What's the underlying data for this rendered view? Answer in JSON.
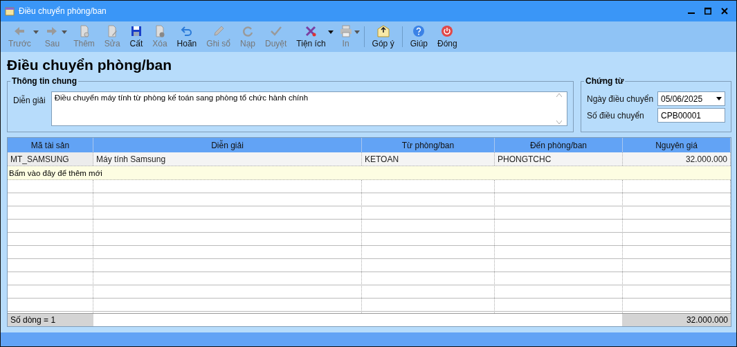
{
  "window": {
    "title": "Điều chuyển phòng/ban"
  },
  "toolbar_groups": [
    {
      "items": [
        {
          "label": "Trước",
          "disabled": true,
          "dropdown": true
        },
        {
          "label": "Sau",
          "disabled": true,
          "dropdown": true
        },
        {
          "label": "Thêm",
          "disabled": true,
          "dropdown": false
        },
        {
          "label": "Sửa",
          "disabled": true,
          "dropdown": false
        },
        {
          "label": "Cất",
          "disabled": false,
          "dropdown": false
        },
        {
          "label": "Xóa",
          "disabled": true,
          "dropdown": false
        },
        {
          "label": "Hoãn",
          "disabled": false,
          "dropdown": false
        },
        {
          "label": "Ghi sổ",
          "disabled": true,
          "dropdown": false
        },
        {
          "label": "Nạp",
          "disabled": true,
          "dropdown": false
        },
        {
          "label": "Duyệt",
          "disabled": true,
          "dropdown": false
        },
        {
          "label": "Tiện ích",
          "disabled": false,
          "dropdown": true
        },
        {
          "label": "In",
          "disabled": true,
          "dropdown": true
        }
      ]
    },
    {
      "items": [
        {
          "label": "Góp ý",
          "disabled": false,
          "dropdown": false
        }
      ]
    },
    {
      "items": [
        {
          "label": "Giúp",
          "disabled": false,
          "dropdown": false
        },
        {
          "label": "Đóng",
          "disabled": false,
          "dropdown": false
        }
      ]
    }
  ],
  "heading": "Điều chuyển phòng/ban",
  "general": {
    "title": "Thông tin chung",
    "label": "Diễn giải",
    "value": "Điều chuyển máy tính từ phòng kế toán sang phòng tổ chức hành chính"
  },
  "voucher": {
    "title": "Chứng từ",
    "date_label": "Ngày điều chuyển",
    "date": "05/06/2025",
    "number_label": "Số điều chuyển",
    "number": "CPB00001"
  },
  "table": {
    "columns": [
      "Mã tài sản",
      "Diễn giải",
      "Từ phòng/ban",
      "Đến phòng/ban",
      "Nguyên giá"
    ],
    "rows": [
      [
        "MT_SAMSUNG",
        "Máy tính Samsung",
        "KETOAN",
        "PHONGTCHC",
        "32.000.000"
      ]
    ],
    "new_row": "Bấm vào đây để thêm mới",
    "footer": {
      "count": "Số dòng = 1",
      "total": "32.000.000"
    }
  }
}
